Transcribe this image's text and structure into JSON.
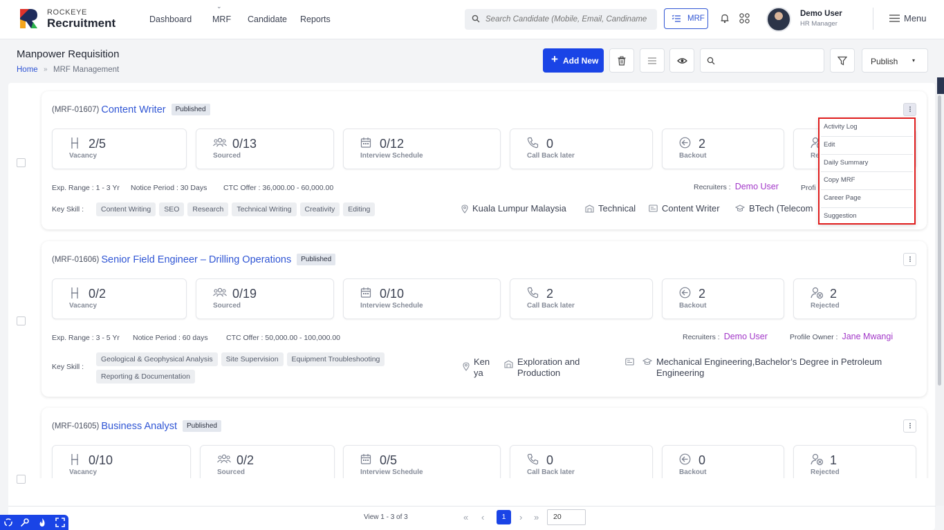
{
  "brand": {
    "small": "ROCKEYE",
    "big": "Recruitment"
  },
  "nav": [
    {
      "label": "Dashboard"
    },
    {
      "label": "MRF"
    },
    {
      "label": "Candidate"
    },
    {
      "label": "Reports"
    }
  ],
  "top_search": {
    "placeholder": "Search Candidate (Mobile, Email, Candiname"
  },
  "mrf_button": "MRF",
  "user": {
    "name": "Demo User",
    "role": "HR Manager"
  },
  "menu_label": "Menu",
  "page": {
    "title": "Manpower Requisition",
    "breadcrumb_home": "Home",
    "breadcrumb_sep": "»",
    "breadcrumb_current": "MRF Management"
  },
  "toolbar": {
    "add_label": "Add New",
    "add_plus": "+",
    "publish_label": "Publish",
    "publish_caret": "▾",
    "search_placeholder": ""
  },
  "stat_labels": {
    "vacancy": "Vacancy",
    "sourced": "Sourced",
    "interview": "Interview Schedule",
    "callback": "Call Back later",
    "backout": "Backout",
    "rejected": "Rejected"
  },
  "meta_labels": {
    "exp": "Exp. Range :",
    "notice": "Notice Period :",
    "ctc": "CTC Offer :",
    "recruiters": "Recruiters :",
    "owner": "Profile Owner :",
    "owner_short": "Profi",
    "keyskill": "Key Skill :"
  },
  "cards": [
    {
      "code": "(MRF-01607)",
      "title": "Content Writer",
      "status": "Published",
      "stats": {
        "vacancy": "2/5",
        "sourced": "0/13",
        "interview": "0/12",
        "callback": "0",
        "backout": "2",
        "rejected": "",
        "rejected_label": "Re"
      },
      "exp": "1 - 3 Yr",
      "notice": "30 Days",
      "ctc": "36,000.00 - 60,000.00",
      "recruiter": "Demo User",
      "owner": "",
      "skills": [
        "Content Writing",
        "SEO",
        "Research",
        "Technical Writing",
        "Creativity",
        "Editing"
      ],
      "location": "Kuala Lumpur Malaysia",
      "department": "Technical",
      "designation": "Content Writer",
      "education": "BTech (Telecom"
    },
    {
      "code": "(MRF-01606)",
      "title": "Senior Field Engineer – Drilling Operations",
      "status": "Published",
      "stats": {
        "vacancy": "0/2",
        "sourced": "0/19",
        "interview": "0/10",
        "callback": "2",
        "backout": "2",
        "rejected": "2"
      },
      "exp": "3 - 5 Yr",
      "notice": "60 days",
      "ctc": "50,000.00 - 100,000.00",
      "recruiter": "Demo User",
      "owner": "Jane Mwangi",
      "skills": [
        "Geological & Geophysical Analysis",
        "Site Supervision",
        "Equipment Troubleshooting",
        "Reporting & Documentation"
      ],
      "location": "Ken ya",
      "department": "Exploration and Production",
      "designation": "",
      "education": "Mechanical Engineering,Bachelor’s Degree in Petroleum Engineering"
    },
    {
      "code": "(MRF-01605)",
      "title": "Business Analyst",
      "status": "Published",
      "stats": {
        "vacancy": "0/10",
        "sourced": "0/2",
        "interview": "0/5",
        "callback": "0",
        "backout": "0",
        "rejected": "1"
      }
    }
  ],
  "dropdown": [
    "Activity Log",
    "Edit",
    "Daily Summary",
    "Copy MRF",
    "Career Page",
    "Suggestion"
  ],
  "pagination": {
    "view": "View 1 - 3 of 3",
    "current": "1",
    "page_size": "20"
  },
  "colors": {
    "primary": "#1a44e6",
    "link": "#2f55d4",
    "recruiter": "#a237c8",
    "highlight": "#e01c1c"
  }
}
